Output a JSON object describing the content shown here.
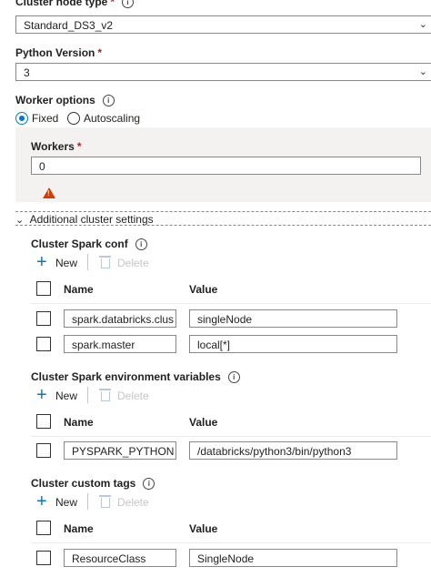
{
  "node_type": {
    "label": "Cluster node type",
    "required": "*",
    "value": "Standard_DS3_v2"
  },
  "python": {
    "label": "Python Version",
    "required": "*",
    "value": "3"
  },
  "worker_options": {
    "label": "Worker options",
    "options": [
      {
        "label": "Fixed",
        "selected": true
      },
      {
        "label": "Autoscaling",
        "selected": false
      }
    ],
    "workers": {
      "label": "Workers",
      "required": "*",
      "value": "0"
    }
  },
  "additional": {
    "label": "Additional cluster settings"
  },
  "toolbar": {
    "new_label": "New",
    "delete_label": "Delete"
  },
  "table_headers": {
    "name": "Name",
    "value": "Value"
  },
  "spark_conf": {
    "title": "Cluster Spark conf",
    "rows": [
      {
        "name": "spark.databricks.clus",
        "value": "singleNode"
      },
      {
        "name": "spark.master",
        "value": "local[*]"
      }
    ]
  },
  "env_vars": {
    "title": "Cluster Spark environment variables",
    "rows": [
      {
        "name": "PYSPARK_PYTHON",
        "value": "/databricks/python3/bin/python3"
      }
    ]
  },
  "custom_tags": {
    "title": "Cluster custom tags",
    "rows": [
      {
        "name": "ResourceClass",
        "value": "SingleNode"
      }
    ]
  },
  "colors": {
    "accent": "#0078d4",
    "required": "#a4262c",
    "warning": "#d83b01"
  },
  "icons": [
    "info-icon",
    "chevron-down-icon",
    "warning-icon",
    "plus-icon",
    "trash-icon"
  ]
}
